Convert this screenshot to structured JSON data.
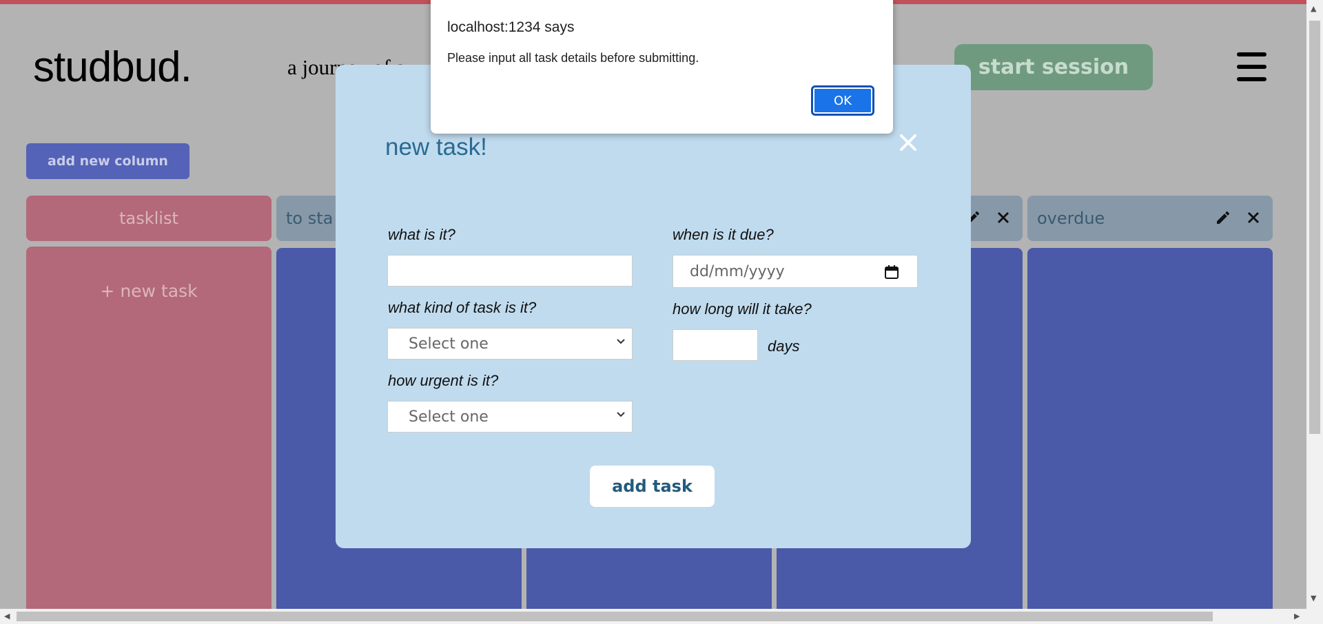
{
  "app": {
    "logo": "studbud.",
    "tagline": "a journey of a",
    "start_session_label": "start session"
  },
  "board": {
    "add_column_label": "add new column",
    "columns": [
      {
        "title": "tasklist",
        "action": "+ new task"
      },
      {
        "title": "to sta"
      },
      {
        "title": ""
      },
      {
        "title": ""
      },
      {
        "title": "overdue"
      }
    ]
  },
  "modal": {
    "title": "new task!",
    "fields": {
      "what": {
        "label": "what is it?",
        "value": ""
      },
      "kind": {
        "label": "what kind of task is it?",
        "selected": "Select one"
      },
      "urgency": {
        "label": "how urgent is it?",
        "selected": "Select one"
      },
      "due": {
        "label": "when is it due?",
        "placeholder": "dd/mm/yyyy"
      },
      "duration": {
        "label": "how long will it take?",
        "value": "",
        "unit": "days"
      }
    },
    "submit_label": "add task"
  },
  "alert": {
    "title": "localhost:1234 says",
    "message": "Please input all task details before submitting.",
    "ok_label": "OK"
  },
  "colors": {
    "background": "#b3b3b3",
    "tasklist": "#b3697a",
    "column": "#4a59a8",
    "column_header": "#8799a8",
    "modal": "#c0dbee",
    "start_button": "#6f9a80",
    "ok_button": "#1a73e8"
  }
}
